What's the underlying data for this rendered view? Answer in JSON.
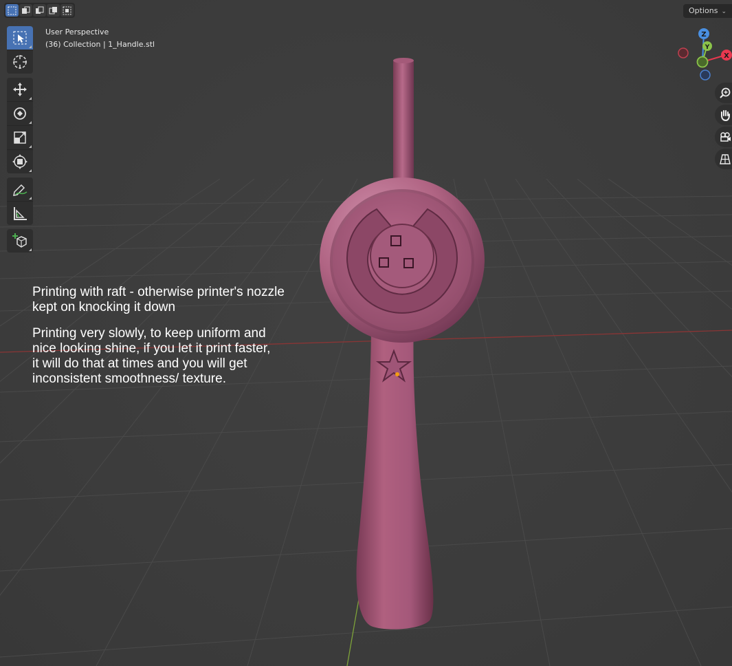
{
  "header": {
    "options_label": "Options",
    "selection_modes": [
      "select-new-icon",
      "select-extend-icon",
      "select-subtract-icon",
      "select-difference-icon",
      "select-intersect-icon"
    ]
  },
  "toolbar": {
    "tools": [
      "select-box-icon",
      "cursor-icon",
      "move-icon",
      "rotate-icon",
      "scale-icon",
      "transform-icon",
      "annotate-icon",
      "measure-icon",
      "add-cube-icon"
    ],
    "active_tool": "select-box-icon"
  },
  "viewport_info": {
    "view_name": "User Perspective",
    "collection": "(36) Collection | 1_Handle.stl"
  },
  "notes": [
    "Printing with raft - otherwise printer's nozzle kept on knocking it down",
    "Printing very slowly, to keep uniform and nice looking shine, if you let it print faster, it will do that at times and you will get inconsistent smoothness/ texture."
  ],
  "gizmo": {
    "axes": {
      "x_label": "X",
      "y_label": "Y",
      "z_label": "Z"
    },
    "colors": {
      "x": "#e8384f",
      "y": "#8bc34a",
      "z": "#4a90e2",
      "neg_x": "#b03040",
      "neg_y": "#6a9a30",
      "neg_z": "#3b70c0"
    }
  },
  "nav": {
    "buttons": [
      "zoom-icon",
      "pan-hand-icon",
      "camera-icon",
      "ortho-grid-icon"
    ]
  },
  "colors": {
    "model": "#b0607f",
    "model_dark": "#7a3c55",
    "model_light": "#d490ad",
    "x_axis_line": "#a03a3a",
    "y_axis_line": "#7ea33a",
    "accent": "#4772b3",
    "origin_dot": "#f39c12"
  }
}
